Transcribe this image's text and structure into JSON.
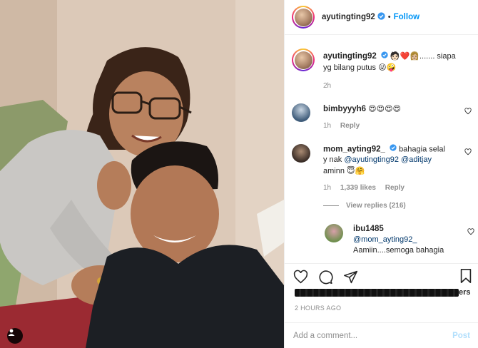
{
  "post": {
    "author": "ayutingting92",
    "follow_label": "Follow",
    "dot": "•"
  },
  "caption": {
    "username": "ayutingting92",
    "emojis": "🧑🏻❤️👩🏼",
    "text": "....... siapa yg bilang putus",
    "trailing_emojis": "😜🤪",
    "time": "2h"
  },
  "comments": [
    {
      "username": "bimbyyyh6",
      "text": "😍😍😍😍",
      "time": "1h",
      "reply_label": "Reply"
    },
    {
      "username": "mom_ayting92_",
      "text_a": "bahagia selal",
      "text_b": "y nak",
      "mention_1": "@ayutingting92",
      "mention_2": "@aditjay",
      "text_c": "aminn",
      "emojis": "😇🤗",
      "time": "1h",
      "likes": "1,339 likes",
      "reply_label": "Reply"
    }
  ],
  "view_replies": "View replies (216)",
  "reply": {
    "username": "ibu1485",
    "mention": "@mom_ayting92_",
    "text": "Aamiin....semoga bahagia"
  },
  "likes_suffix": "ers",
  "date": "2 HOURS AGO",
  "add_comment": {
    "placeholder": "Add a comment...",
    "post_label": "Post"
  },
  "colors": {
    "accent": "#0095f6",
    "post_disabled": "#b2dffc",
    "verified": "#3897f0",
    "heart": "#ed4956"
  },
  "icons": [
    "verified-badge-icon",
    "heart-icon",
    "comment-icon",
    "share-icon",
    "bookmark-icon",
    "user-tag-icon"
  ]
}
